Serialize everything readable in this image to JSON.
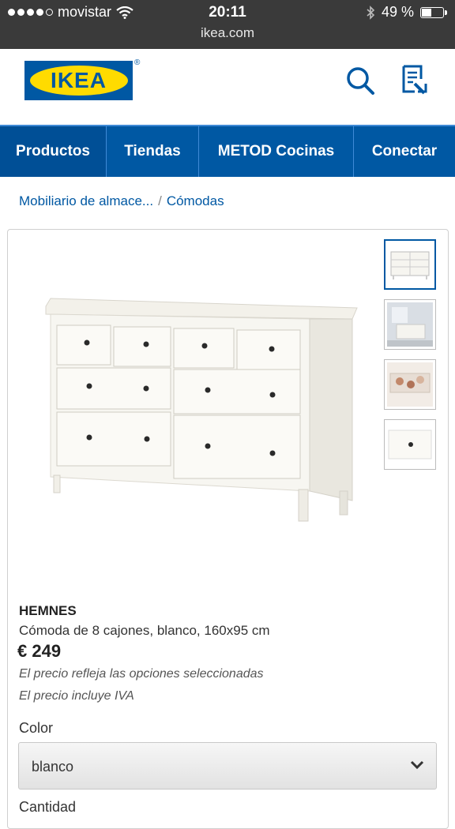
{
  "status": {
    "carrier": "movistar",
    "time": "20:11",
    "url": "ikea.com",
    "battery": "49 %",
    "battery_level": 0.49
  },
  "header": {
    "logo_text": "IKEA",
    "reg_mark": "®"
  },
  "nav": {
    "items": [
      {
        "label": "Productos"
      },
      {
        "label": "Tiendas"
      },
      {
        "label": "METOD Cocinas"
      },
      {
        "label": "Conectar"
      }
    ]
  },
  "breadcrumb": {
    "parent": "Mobiliario de almace...",
    "separator": "/",
    "current": "Cómodas"
  },
  "product": {
    "brand": "HEMNES",
    "description": "Cómoda de 8 cajones, blanco, 160x95 cm",
    "price": "€ 249",
    "note1": "El precio refleja las opciones seleccionadas",
    "note2": "El precio incluye IVA"
  },
  "options": {
    "color_label": "Color",
    "color_value": "blanco",
    "quantity_label": "Cantidad"
  },
  "colors": {
    "brand_blue": "#0058a3",
    "brand_yellow": "#ffdb00",
    "link": "#0058a3"
  }
}
